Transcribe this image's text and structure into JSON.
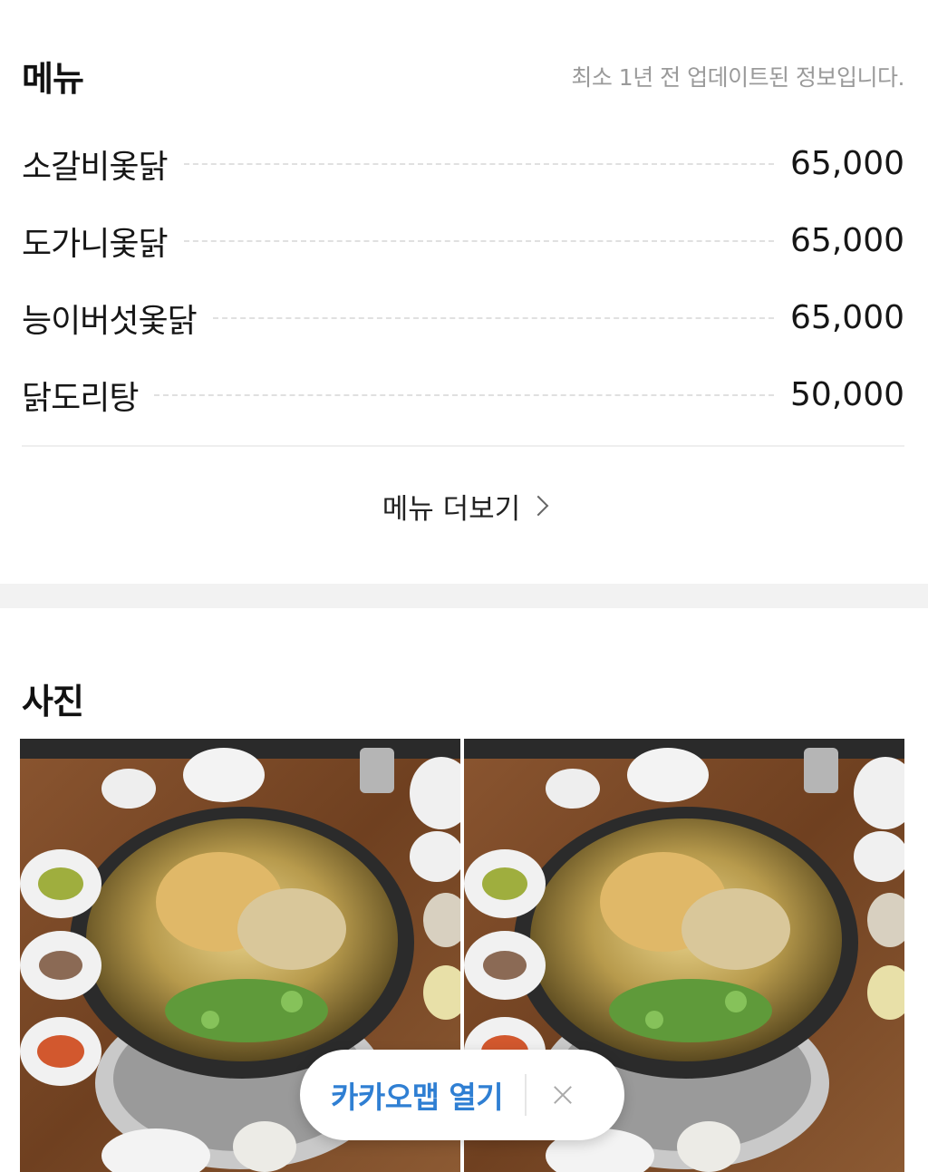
{
  "menu": {
    "title": "메뉴",
    "update_note": "최소 1년 전 업데이트된 정보입니다.",
    "items": [
      {
        "name": "소갈비옻닭",
        "price": "65,000"
      },
      {
        "name": "도가니옻닭",
        "price": "65,000"
      },
      {
        "name": "능이버섯옻닭",
        "price": "65,000"
      },
      {
        "name": "닭도리탕",
        "price": "50,000"
      }
    ],
    "more_label": "메뉴 더보기"
  },
  "photos": {
    "title": "사진",
    "items": [
      {
        "subject": "옻닭 전골 상차림"
      },
      {
        "subject": "옻닭 전골 상차림"
      }
    ]
  },
  "banner": {
    "open_label": "카카오맵 열기",
    "accent_color": "#2f7fd3"
  }
}
